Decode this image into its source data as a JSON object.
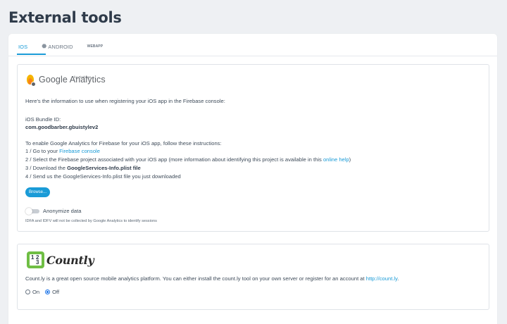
{
  "page": {
    "title": "External tools"
  },
  "tabs": [
    {
      "label": "IOS",
      "icon": "apple-icon",
      "active": true
    },
    {
      "label": "ANDROID",
      "icon": "android-icon",
      "active": false
    },
    {
      "label": "WEBAPP",
      "icon": "webapp-icon",
      "active": false
    }
  ],
  "google_analytics": {
    "logo_title": "Google Analytics",
    "logo_subtitle": "for Firebase",
    "intro": "Here's the information to use when registering your iOS app in the Firebase console:",
    "bundle_label": "iOS Bundle ID:",
    "bundle_id": "com.goodbarber.gbuistylev2",
    "instructions_intro": "To enable Google Analytics for Firebase for your iOS app, follow these instructions:",
    "step1_prefix": "1 / Go to your ",
    "step1_link": "Firebase console",
    "step2_prefix": "2 / Select the Firebase project associated with your iOS app (more information about identifying this project is available in this ",
    "step2_link": "online help",
    "step2_suffix": ")",
    "step3_prefix": "3 / Download the ",
    "step3_bold": "GoogleServices-Info.plist file",
    "step4": "4 / Send us the GoogleServices-Info.plist file you just downloaded",
    "browse_label": "Browse...",
    "anonymize_label": "Anonymize data",
    "anonymize_enabled": false,
    "anonymize_note": "IDFA and IDFV will not be collected by Google Analytics to identify sessions"
  },
  "countly": {
    "logo_word": "Countly",
    "icon_digits": [
      "1",
      "2",
      "3"
    ],
    "description_prefix": "Count.ly is a great open source mobile analytics platform. You can either install the count.ly tool on your own server or register for an account at ",
    "description_link": "http://count.ly",
    "description_suffix": ".",
    "options": [
      {
        "label": "On",
        "checked": false
      },
      {
        "label": "Off",
        "checked": true
      }
    ]
  },
  "colors": {
    "accent": "#1a9bd7",
    "background": "#eef0f3",
    "countly_green": "#6fbe44"
  }
}
